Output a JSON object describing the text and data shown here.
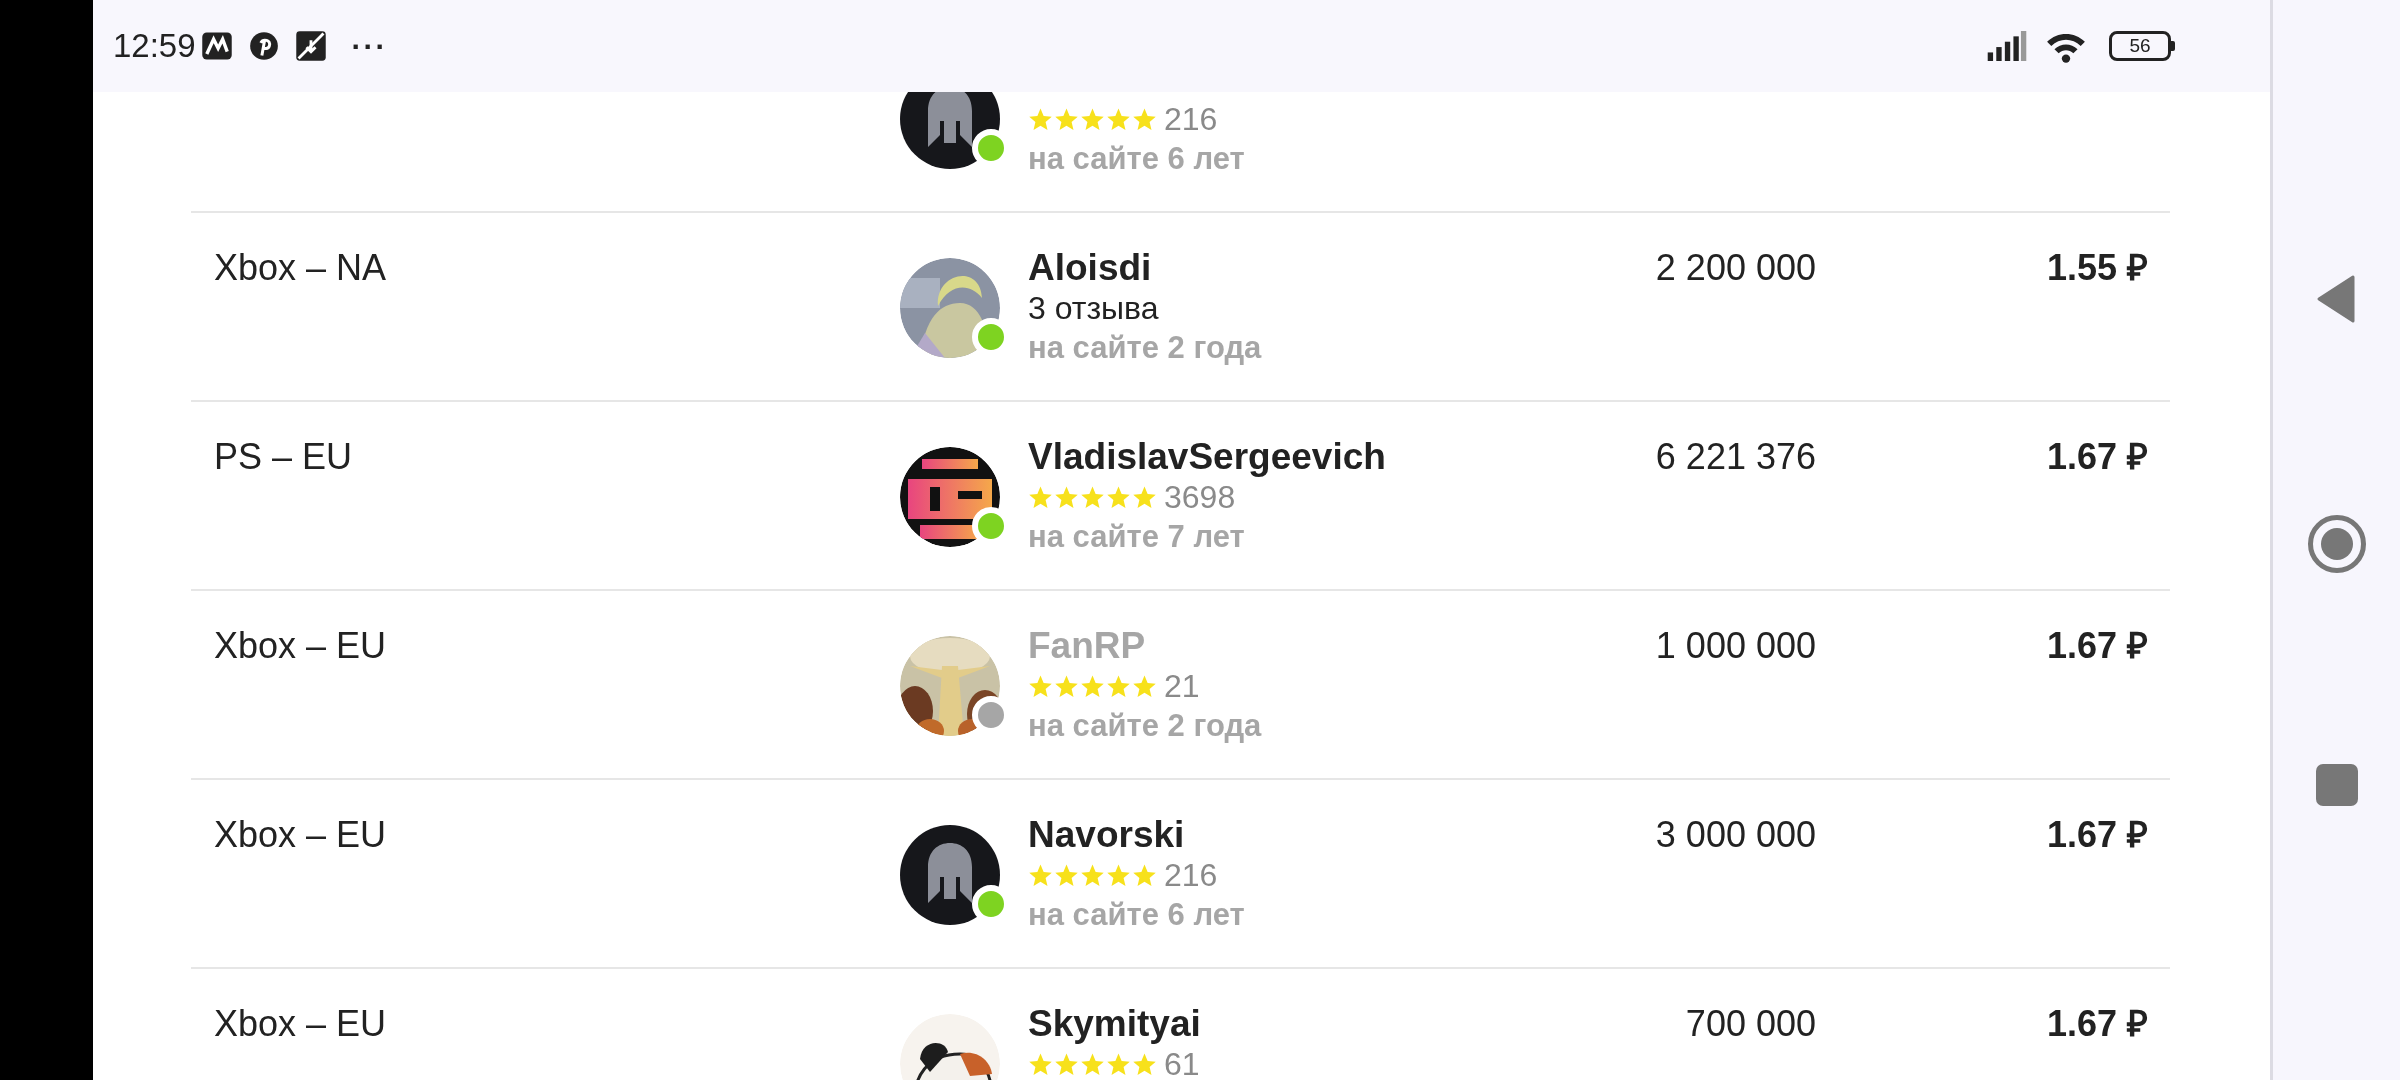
{
  "status_bar": {
    "time": "12:59",
    "more": "···",
    "battery": "56"
  },
  "offers": [
    {
      "online": true,
      "stars": 5,
      "reviews": "216",
      "since": "на сайте 6 лет",
      "avatar": {
        "kind": "helmet"
      }
    },
    {
      "region": "Xbox – NA",
      "name": "Aloisdi",
      "online": true,
      "reviews": "3 отзыва",
      "since": "на сайте 2 года",
      "amount": "2 200 000",
      "price": "1.55 ₽"
    },
    {
      "region": "PS – EU",
      "name": "VladislavSergeevich",
      "online": true,
      "stars": 5,
      "reviews": "3698",
      "since": "на сайте 7 лет",
      "amount": "6 221 376",
      "price": "1.67 ₽"
    },
    {
      "region": "Xbox – EU",
      "name": "FanRP",
      "online": false,
      "stars": 5,
      "reviews": "21",
      "since": "на сайте 2 года",
      "amount": "1 000 000",
      "price": "1.67 ₽"
    },
    {
      "region": "Xbox – EU",
      "name": "Navorski",
      "online": true,
      "stars": 5,
      "reviews": "216",
      "since": "на сайте 6 лет",
      "amount": "3 000 000",
      "price": "1.67 ₽",
      "avatar": {
        "kind": "helmet"
      }
    },
    {
      "region": "Xbox – EU",
      "name": "Skymityai",
      "stars": 5,
      "reviews": "61",
      "amount": "700 000",
      "price": "1.67 ₽"
    }
  ]
}
